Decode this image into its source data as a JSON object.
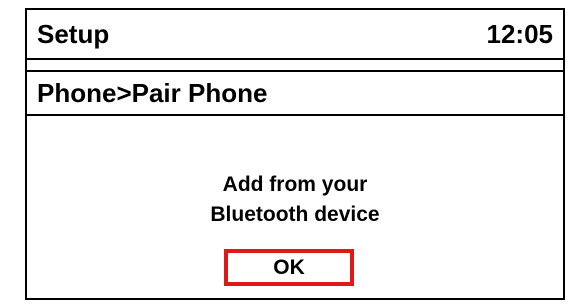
{
  "header": {
    "title": "Setup",
    "time": "12:05"
  },
  "breadcrumb": {
    "text": "Phone>Pair Phone"
  },
  "dialog": {
    "message_line1": "Add from your",
    "message_line2": "Bluetooth device",
    "ok_label": "OK"
  },
  "colors": {
    "focus_outline": "#e01818",
    "text": "#000000",
    "background": "#ffffff"
  }
}
